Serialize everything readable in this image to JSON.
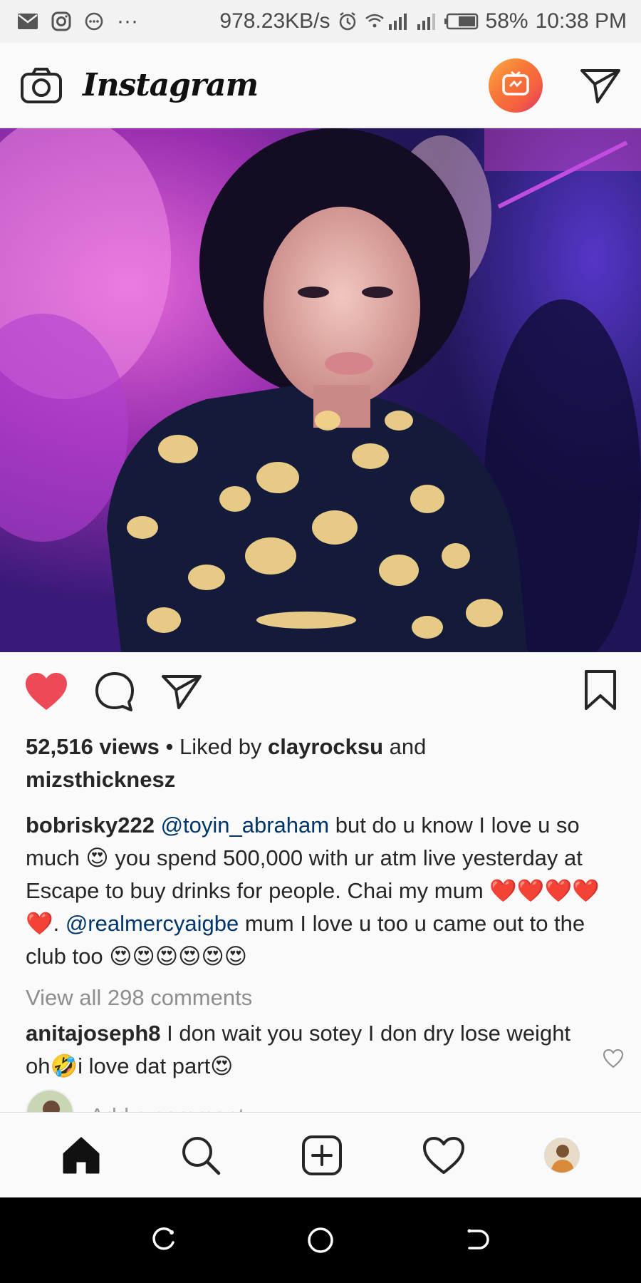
{
  "status_bar": {
    "network_speed": "978.23KB/s",
    "battery": "58%",
    "time": "10:38 PM",
    "more": "···"
  },
  "app": {
    "title": "Instagram"
  },
  "post": {
    "views": "52,516 views",
    "liked_by_prefix": " • Liked by ",
    "liked_by_user": "clayrocksu",
    "liked_by_and": " and",
    "liked_by_user2": "mizsthicknesz",
    "caption_user": "bobrisky222",
    "caption_mention1": "@toyin_abraham",
    "caption_part1": " but do u know I love u so much 😍 you spend 500,000 with ur atm live yesterday at Escape to buy drinks for people. Chai my mum ❤️❤️❤️❤️❤️. ",
    "caption_mention2": "@realmercyaigbe",
    "caption_part2": " mum I love u too u came out to the club too 😍😍😍😍😍😍",
    "view_all_comments": "View all 298 comments",
    "comment_user": "anitajoseph8",
    "comment_text": " I don wait you sotey I don dry lose weight oh🤣i love dat part😍",
    "add_comment_placeholder": "Add a comment..."
  },
  "icons": {
    "like": "heart-filled-icon",
    "comment": "comment-icon",
    "share": "direct-share-icon",
    "save": "bookmark-icon",
    "camera": "camera-icon",
    "igtv": "igtv-icon",
    "direct": "direct-message-icon",
    "home": "home-icon",
    "search": "search-icon",
    "new_post": "add-post-icon",
    "activity": "heart-outline-icon"
  },
  "colors": {
    "like_red": "#ed4956",
    "link_blue": "#003569",
    "muted_gray": "#8e8e8e"
  }
}
